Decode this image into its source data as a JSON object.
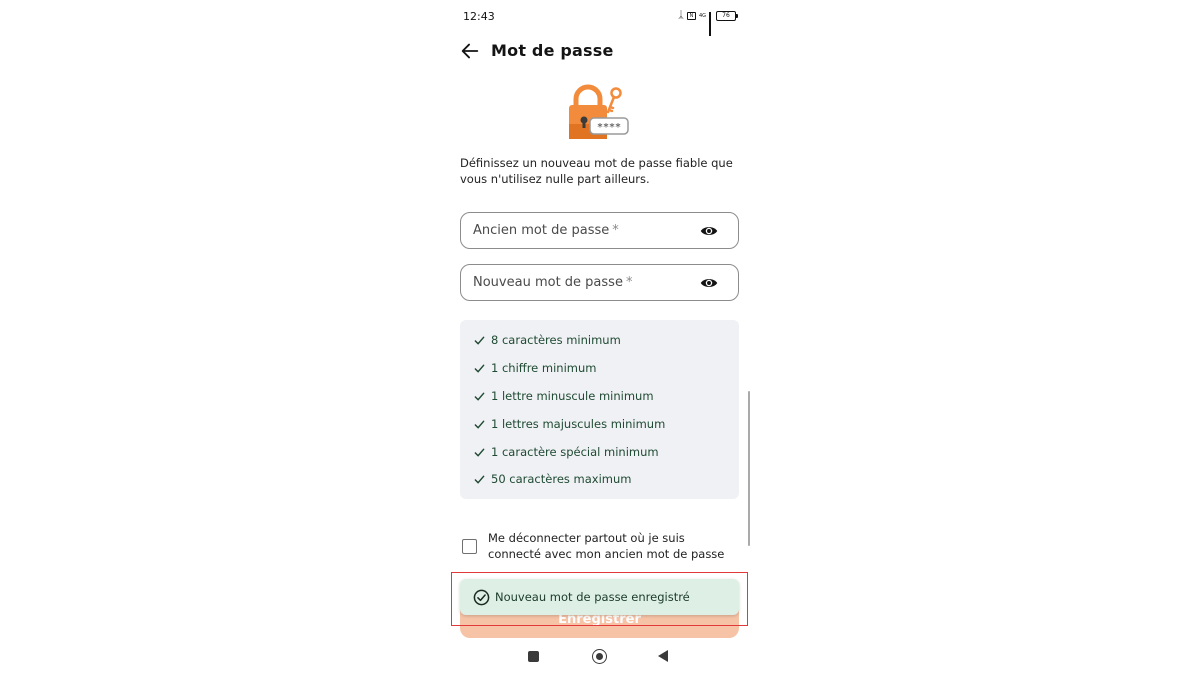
{
  "status_bar": {
    "time": "12:43",
    "lte_label": "4G",
    "sim_label": "N",
    "battery": "76"
  },
  "header": {
    "title": "Mot de passe"
  },
  "intro_text": "Définissez un nouveau mot de passe fiable que vous n'utilisez nulle part ailleurs.",
  "illustration": {
    "password_mask": "****"
  },
  "fields": {
    "old_password": {
      "label": "Ancien mot de passe",
      "required_mark": "*"
    },
    "new_password": {
      "label": "Nouveau mot de passe",
      "required_mark": "*"
    }
  },
  "rules": [
    {
      "label": "8 caractères minimum"
    },
    {
      "label": "1 chiffre minimum"
    },
    {
      "label": "1 lettre minuscule minimum"
    },
    {
      "label": "1 lettres majuscules minimum"
    },
    {
      "label": "1 caractère spécial minimum"
    },
    {
      "label": "50 caractères maximum"
    }
  ],
  "logout_option": {
    "label": "Me déconnecter partout où je suis connecté avec mon ancien mot de passe",
    "checked": false
  },
  "save_button": {
    "label": "Enregistrer"
  },
  "toast": {
    "message": "Nouveau mot de passe enregistré"
  },
  "colors": {
    "accent": "#f28c3c",
    "accent_disabled": "#f6c3a6",
    "success_text": "#1f4a33",
    "toast_bg": "#def0e6",
    "highlight": "#e2393b"
  }
}
